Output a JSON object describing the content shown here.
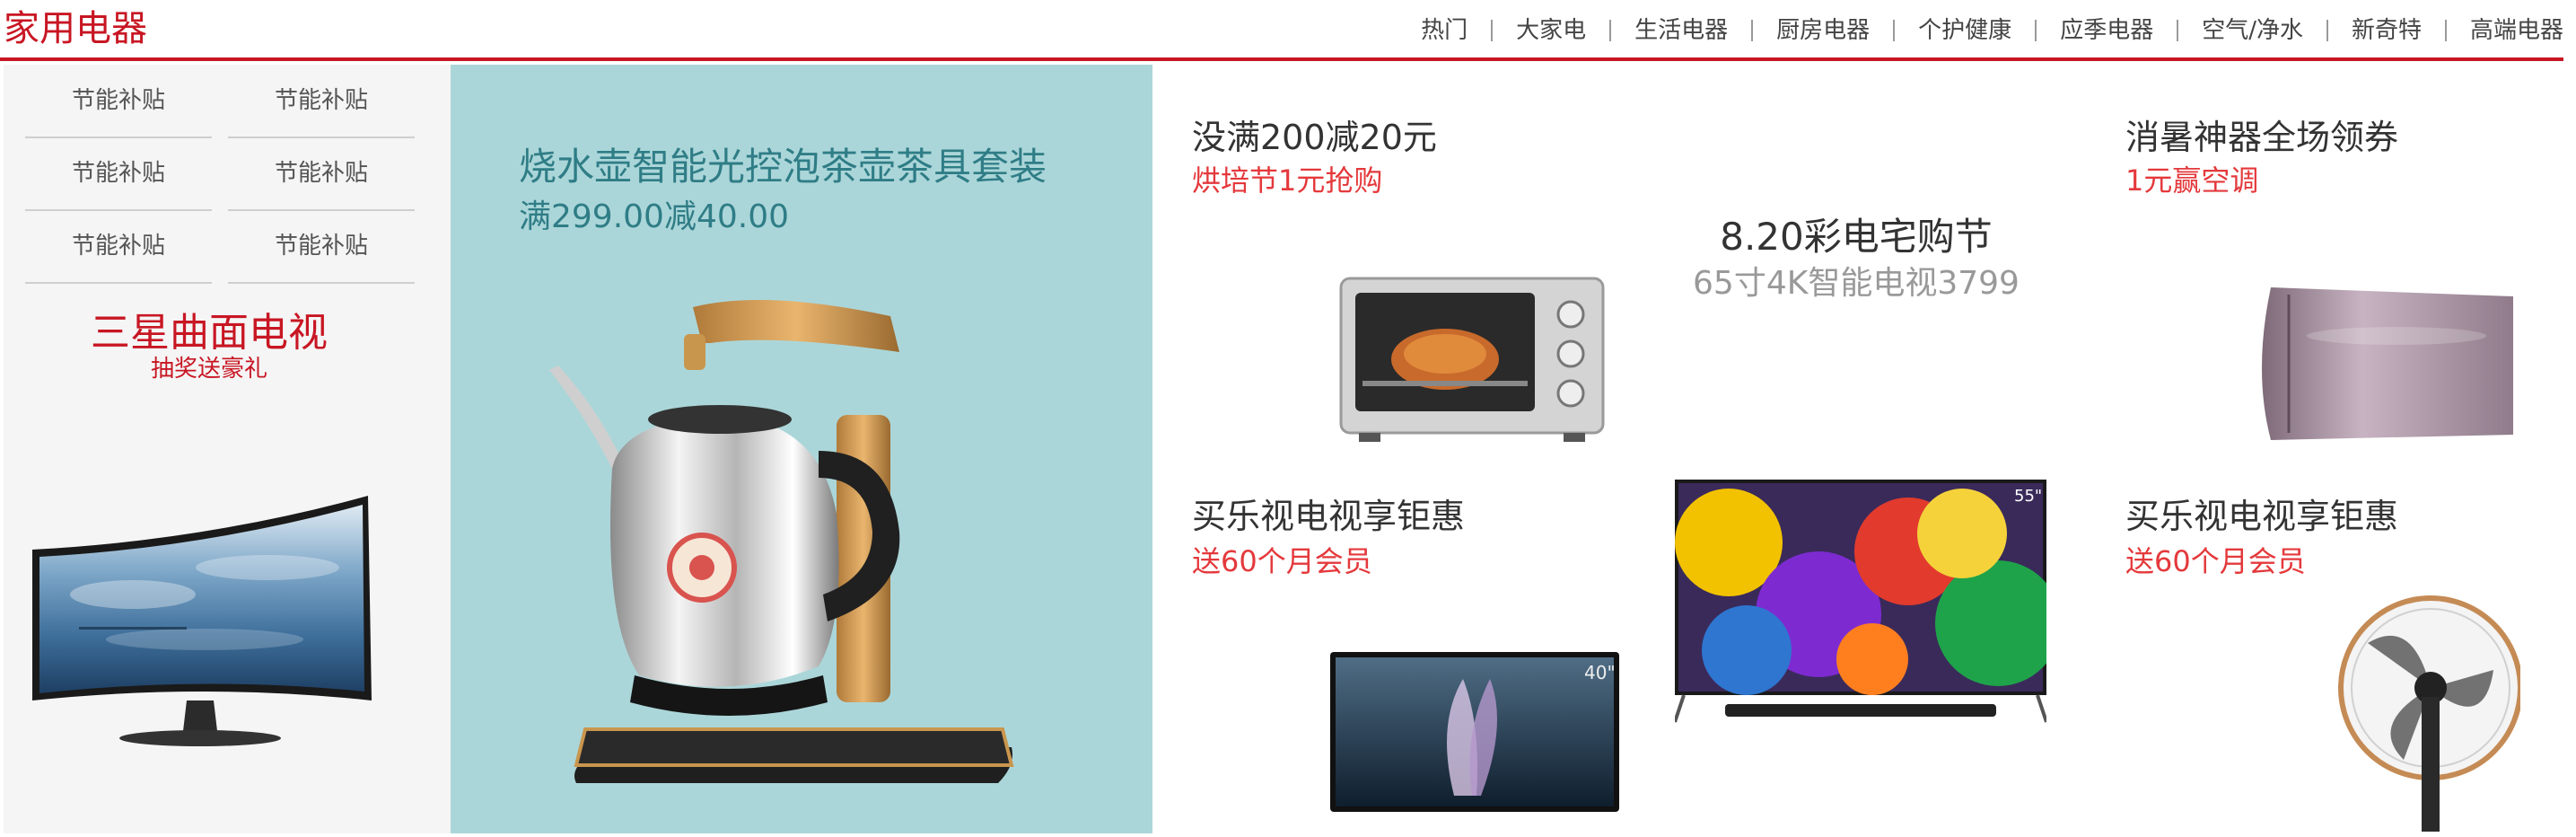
{
  "header": {
    "title": "家用电器",
    "nav": [
      "热门",
      "大家电",
      "生活电器",
      "厨房电器",
      "个护健康",
      "应季电器",
      "空气/净水",
      "新奇特",
      "高端电器"
    ]
  },
  "sidebar": {
    "links": [
      "节能补贴",
      "节能补贴",
      "节能补贴",
      "节能补贴",
      "节能补贴",
      "节能补贴"
    ],
    "promo_title": "三星曲面电视",
    "promo_subtitle": "抽奖送豪礼"
  },
  "feature": {
    "title": "烧水壶智能光控泡茶壶茶具套装",
    "subtitle": "满299.00减40.00"
  },
  "tiles": {
    "oven": {
      "title": "没满200减20元",
      "subtitle": "烘培节1元抢购"
    },
    "center": {
      "title": "8.20彩电宅购节",
      "subtitle": "65寸4K智能电视3799"
    },
    "ac": {
      "title": "消暑神器全场领券",
      "subtitle": "1元赢空调"
    },
    "tv_left": {
      "title": "买乐视电视享钜惠",
      "subtitle": "送60个月会员"
    },
    "fan": {
      "title": "买乐视电视享钜惠",
      "subtitle": "送60个月会员"
    }
  },
  "colors": {
    "brand_red": "#c81623",
    "promo_red": "#e4393c",
    "feature_bg": "#abd6d9",
    "feature_text": "#2f7d86"
  },
  "icons": [
    "curved-tv-image",
    "kettle-image",
    "oven-image",
    "air-conditioner-image",
    "tv-image",
    "fan-image"
  ]
}
